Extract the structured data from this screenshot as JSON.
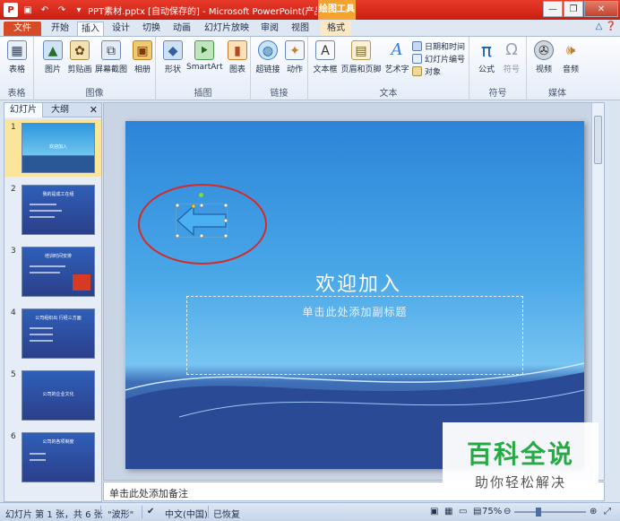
{
  "window": {
    "title": "PPT素材.pptx [自动保存的] - Microsoft PowerPoint(产品激...",
    "context_tools": "绘图工具"
  },
  "tabs": [
    {
      "label": "文件"
    },
    {
      "label": "开始"
    },
    {
      "label": "插入"
    },
    {
      "label": "设计"
    },
    {
      "label": "切换"
    },
    {
      "label": "动画"
    },
    {
      "label": "幻灯片放映"
    },
    {
      "label": "审阅"
    },
    {
      "label": "视图"
    },
    {
      "label": "格式"
    }
  ],
  "ribbon": {
    "groups": {
      "tables": "表格",
      "images": "图像",
      "illustrations": "插图",
      "links": "链接",
      "text": "文本",
      "symbols": "符号",
      "media": "媒体"
    },
    "buttons": {
      "table": "表格",
      "picture": "图片",
      "clipart": "剪贴画",
      "screenshot": "屏幕截图",
      "album": "相册",
      "shapes": "形状",
      "smartart": "SmartArt",
      "chart": "图表",
      "hyperlink": "超链接",
      "action": "动作",
      "textbox": "文本框",
      "header_footer": "页眉和页脚",
      "wordart": "艺术字",
      "date_time": "日期和时间",
      "slide_number": "幻灯片编号",
      "object": "对象",
      "equation": "公式",
      "symbol": "符号",
      "video": "视频",
      "audio": "音频"
    }
  },
  "left_pane": {
    "tab_slides": "幻灯片",
    "tab_outline": "大纲",
    "close": "✕",
    "thumbnails": [
      {
        "num": "1",
        "title": "欢迎加入"
      },
      {
        "num": "2",
        "title": "我的是成工在组"
      },
      {
        "num": "3",
        "title": "培训时间安排"
      },
      {
        "num": "4",
        "title": "公司组织出 行经三方面"
      },
      {
        "num": "5",
        "title": "公司的企业文化"
      },
      {
        "num": "6",
        "title": "公司的各项制度"
      }
    ]
  },
  "slide": {
    "title": "欢迎加入",
    "subtitle_placeholder": "单击此处添加副标题"
  },
  "notes_placeholder": "单击此处添加备注",
  "status": {
    "slide_info": "幻灯片 第 1 张，共 6 张",
    "theme": "\"波形\"",
    "language": "中文(中国)",
    "restored": "已恢复",
    "zoom": "75%"
  },
  "watermark": {
    "title": "百科全说",
    "subtitle": "助你轻松解决"
  },
  "colors": {
    "accent_red": "#c81f12",
    "file_tab": "#d64a26",
    "context_orange": "#f4a230",
    "watermark_green": "#27a944"
  }
}
